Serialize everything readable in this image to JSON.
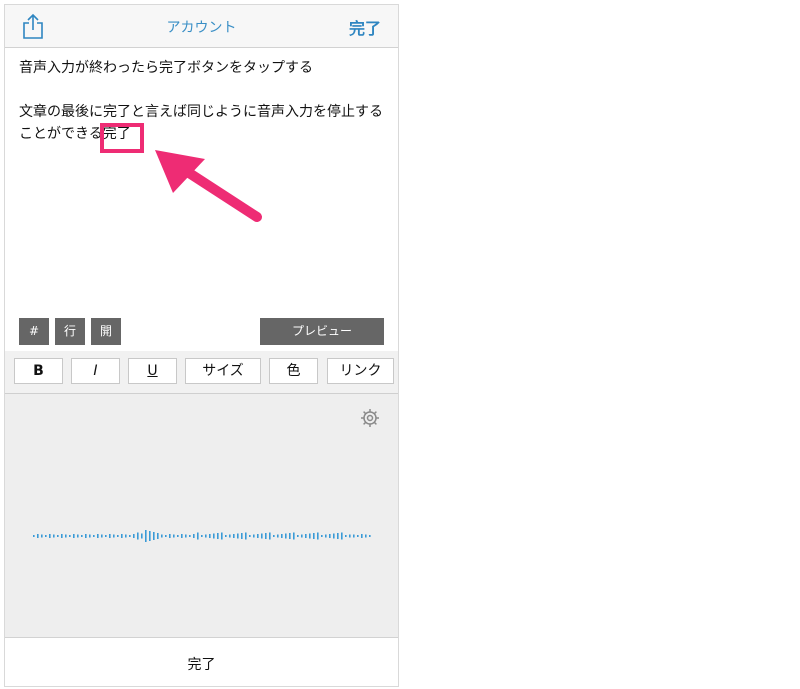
{
  "navbar": {
    "title": "アカウント",
    "done_label": "完了"
  },
  "editor": {
    "lines": [
      "音声入力が終わったら完了ボタンをタップする",
      "文章の最後に完了と言えば同じように音声入力を停止する",
      "ことができる完了"
    ]
  },
  "toolbar": {
    "hash_label": "#",
    "line_label": "行",
    "open_label": "開",
    "preview_label": "プレビュー"
  },
  "style_bar": {
    "bold": "B",
    "italic": "I",
    "underline": "U",
    "size": "サイズ",
    "color": "色",
    "link": "リンク"
  },
  "dictation": {
    "done_label": "完了"
  },
  "colors": {
    "accent": "#2f86c1",
    "highlight": "#ee2c74",
    "waveform": "#3a9ad6",
    "toolbar_button": "#666666"
  },
  "icons": [
    "share-icon",
    "gear-icon",
    "pointer-arrow-icon"
  ]
}
